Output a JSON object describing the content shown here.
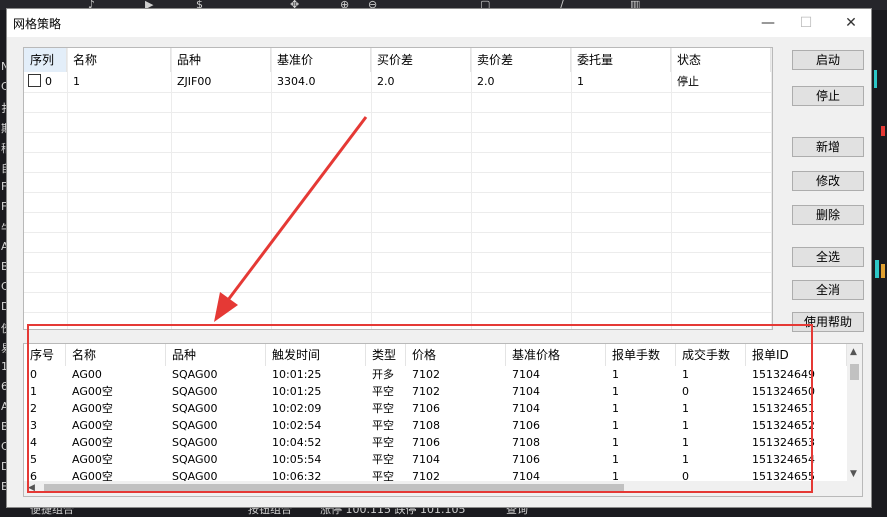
{
  "window": {
    "title": "网格策略"
  },
  "top_table": {
    "columns": [
      "序列",
      "名称",
      "品种",
      "基准价",
      "买价差",
      "卖价差",
      "委托量",
      "状态"
    ],
    "rows": [
      {
        "seq": "0",
        "name": "1",
        "symbol": "ZJIF00",
        "base_price": "3304.0",
        "buy_spread": "2.0",
        "sell_spread": "2.0",
        "order_qty": "1",
        "status": "停止"
      }
    ]
  },
  "buttons": {
    "start": "启动",
    "stop": "停止",
    "add": "新增",
    "edit": "修改",
    "delete": "删除",
    "select_all": "全选",
    "deselect_all": "全消",
    "help": "使用帮助"
  },
  "bottom_table": {
    "columns": [
      "序号",
      "名称",
      "品种",
      "触发时间",
      "类型",
      "价格",
      "基准价格",
      "报单手数",
      "成交手数",
      "报单ID"
    ],
    "rows": [
      [
        "0",
        "AG00",
        "SQAG00",
        "10:01:25",
        "开多",
        "7102",
        "7104",
        "1",
        "1",
        "151324649"
      ],
      [
        "1",
        "AG00空",
        "SQAG00",
        "10:01:25",
        "平空",
        "7102",
        "7104",
        "1",
        "0",
        "151324650"
      ],
      [
        "2",
        "AG00空",
        "SQAG00",
        "10:02:09",
        "平空",
        "7106",
        "7104",
        "1",
        "1",
        "151324651"
      ],
      [
        "3",
        "AG00空",
        "SQAG00",
        "10:02:54",
        "平空",
        "7108",
        "7106",
        "1",
        "1",
        "151324652"
      ],
      [
        "4",
        "AG00空",
        "SQAG00",
        "10:04:52",
        "平空",
        "7106",
        "7108",
        "1",
        "1",
        "151324653"
      ],
      [
        "5",
        "AG00空",
        "SQAG00",
        "10:05:54",
        "平空",
        "7104",
        "7106",
        "1",
        "1",
        "151324654"
      ],
      [
        "6",
        "AG00空",
        "SQAG00",
        "10:06:32",
        "平空",
        "7102",
        "7104",
        "1",
        "0",
        "151324655"
      ]
    ]
  },
  "background": {
    "left_glyphs": [
      "N",
      "C",
      "扌",
      "期",
      "稍",
      "自",
      "F",
      "F",
      "牛",
      "A",
      "B",
      "C",
      "D",
      "佼",
      "易",
      "1",
      "6",
      "A",
      "B",
      "C",
      "D",
      "E"
    ],
    "bottom_texts": [
      "便捷组合",
      "按钮组合",
      "涨停 100.115 跌停 101.105",
      "查询"
    ]
  },
  "colors": {
    "annotation": "#e53935",
    "dialog_bg": "#f0f0f0",
    "app_bg": "#1b1b1f"
  }
}
